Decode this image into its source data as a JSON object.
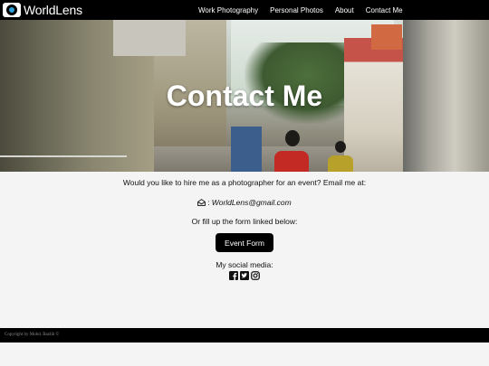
{
  "brand": {
    "name": "WorldLens",
    "logo_icon": "camera-icon"
  },
  "nav": {
    "items": [
      "Work Photography",
      "Personal Photos",
      "About",
      "Contact Me"
    ]
  },
  "hero": {
    "title": "Contact Me"
  },
  "content": {
    "intro": "Would you like to hire me as a photographer for an event? Email me at:",
    "email_icon": "envelope-icon",
    "email_prefix": ": ",
    "email": "WorldLens@gmail.com",
    "fill_text": "Or fill up the form linked below:",
    "form_button": "Event Form",
    "social_label": "My social media:",
    "social_icons": [
      "facebook-icon",
      "twitter-icon",
      "instagram-icon"
    ]
  },
  "footer": {
    "copyright": "Copyright by Mohd. Bazlib ©"
  },
  "colors": {
    "navbar": "#000000",
    "page_bg": "#f4f4f4",
    "button": "#000000",
    "logo_accent": "#2fa0d8"
  }
}
